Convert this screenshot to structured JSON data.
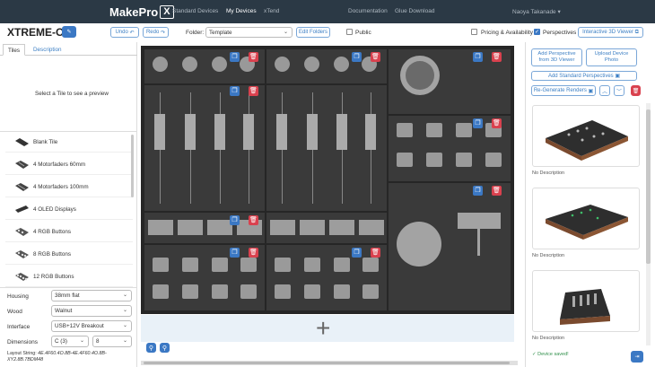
{
  "nav": {
    "brand": "MakePro",
    "brand_box": "X",
    "links": [
      "Standard Devices",
      "My Devices",
      "xTend",
      "Documentation",
      "Glue Download"
    ],
    "active": "My Devices",
    "user": "Naoya Takanade"
  },
  "toolbar": {
    "device_name": "XTREME-C8",
    "undo": "Undo",
    "redo": "Redo",
    "folder_label": "Folder:",
    "folder_value": "Template",
    "edit_folders": "Edit Folders",
    "public": "Public",
    "pricing": "Pricing & Availability",
    "perspectives": "Perspectives",
    "viewer": "Interactive 3D Viewer"
  },
  "left": {
    "tabs": [
      "Tiles",
      "Description"
    ],
    "preview_hint": "Select a Tile to see a preview",
    "tiles": [
      "Blank Tile",
      "4 Motorfaders 60mm",
      "4 Motorfaders 100mm",
      "4 OLED Displays",
      "4 RGB Buttons",
      "8 RGB Buttons",
      "12 RGB Buttons"
    ],
    "props": [
      {
        "label": "Housing",
        "value": "38mm flat"
      },
      {
        "label": "Wood",
        "value": "Walnut"
      },
      {
        "label": "Interface",
        "value": "USB+12V Breakout"
      }
    ],
    "dimensions_label": "Dimensions",
    "dim_a": "C (3)",
    "dim_b": "8",
    "layout_label": "Layout String:",
    "layout_value": "4E.4F60.4O.8B-4E.4F60.4O.8B-XY2.8B.7BDM48"
  },
  "canvas": {
    "add": "+"
  },
  "right": {
    "add_persp": "Add Perspective from 3D Viewer",
    "upload": "Upload Device Photo",
    "add_std": "Add Standard Perspectives",
    "regen": "Re-Generate Renders",
    "no_desc": "No Description",
    "saved": "Device saved!"
  },
  "colors": {
    "nav": "#2b3945",
    "accent": "#3b78c4",
    "danger": "#d9414e"
  }
}
